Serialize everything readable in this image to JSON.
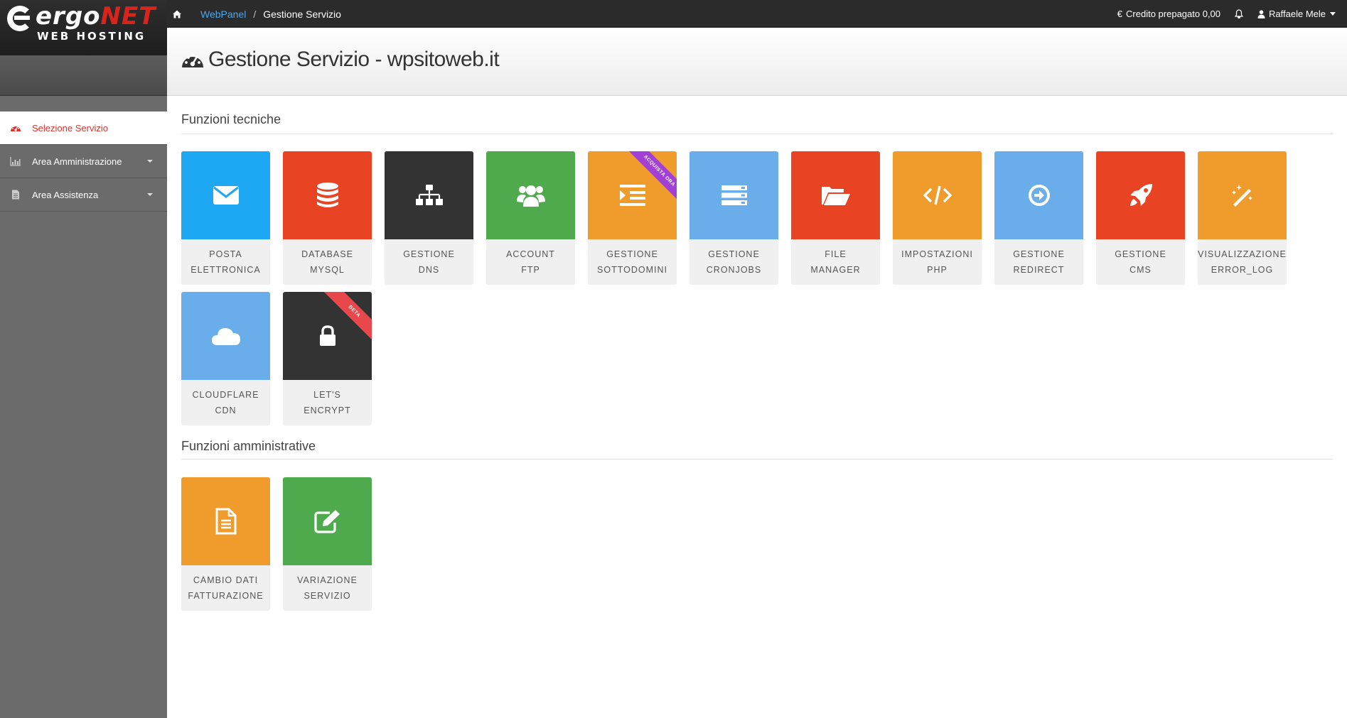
{
  "topbar": {
    "brand_main": "ergo",
    "brand_accent": "NET",
    "brand_sub": "WEB HOSTING",
    "breadcrumb_link": "WebPanel",
    "breadcrumb_sep": "/",
    "breadcrumb_current": "Gestione Servizio",
    "credit_label": "Credito prepagato 0,00",
    "user_name": "Raffaele Mele"
  },
  "sidebar": {
    "items": [
      {
        "label": "Selezione Servizio",
        "icon": "dashboard-icon"
      },
      {
        "label": "Area Amministrazione",
        "icon": "bar-chart-icon"
      },
      {
        "label": "Area Assistenza",
        "icon": "document-icon"
      }
    ]
  },
  "page": {
    "title": "Gestione Servizio - wpsitoweb.it"
  },
  "sections": {
    "technical_title": "Funzioni tecniche",
    "admin_title": "Funzioni amministrative"
  },
  "tiles": {
    "posta": {
      "line1": "POSTA",
      "line2": "ELETTRONICA",
      "color": "#1ea7f2",
      "icon": "envelope-icon"
    },
    "database": {
      "line1": "DATABASE",
      "line2": "MYSQL",
      "color": "#e84423",
      "icon": "database-icon"
    },
    "dns": {
      "line1": "GESTIONE",
      "line2": "DNS",
      "color": "#333333",
      "icon": "sitemap-icon"
    },
    "ftp": {
      "line1": "ACCOUNT",
      "line2": "FTP",
      "color": "#4faa4e",
      "icon": "users-icon"
    },
    "sottodomini": {
      "line1": "GESTIONE",
      "line2": "SOTTODOMINI",
      "color": "#f09c2c",
      "icon": "indent-icon",
      "ribbon": "ACQUISTA ORA",
      "ribbon_color": "#a23fd6"
    },
    "cronjobs": {
      "line1": "GESTIONE",
      "line2": "CRONJOBS",
      "color": "#6aadeb",
      "icon": "server-icon"
    },
    "filemanager": {
      "line1": "FILE",
      "line2": "MANAGER",
      "color": "#e84423",
      "icon": "folder-open-icon"
    },
    "php": {
      "line1": "IMPOSTAZIONI",
      "line2": "PHP",
      "color": "#f09c2c",
      "icon": "code-icon"
    },
    "redirect": {
      "line1": "GESTIONE",
      "line2": "REDIRECT",
      "color": "#6aadeb",
      "icon": "arrow-circle-icon"
    },
    "cms": {
      "line1": "GESTIONE",
      "line2": "CMS",
      "color": "#e84423",
      "icon": "rocket-icon"
    },
    "errorlog": {
      "line1": "VISUALIZZAZIONE",
      "line2": "ERROR_LOG",
      "color": "#f09c2c",
      "icon": "magic-wand-icon"
    },
    "cloudflare": {
      "line1": "CLOUDFLARE",
      "line2": "CDN",
      "color": "#6aadeb",
      "icon": "cloud-icon"
    },
    "letsencrypt": {
      "line1": "LET'S",
      "line2": "ENCRYPT",
      "color": "#333333",
      "icon": "lock-icon",
      "ribbon": "BETA",
      "ribbon_color": "#e8484b"
    },
    "fatturazione": {
      "line1": "CAMBIO DATI",
      "line2": "FATTURAZIONE",
      "color": "#f09c2c",
      "icon": "file-text-icon"
    },
    "variazione": {
      "line1": "VARIAZIONE",
      "line2": "SERVIZIO",
      "color": "#4faa4e",
      "icon": "edit-icon"
    }
  }
}
